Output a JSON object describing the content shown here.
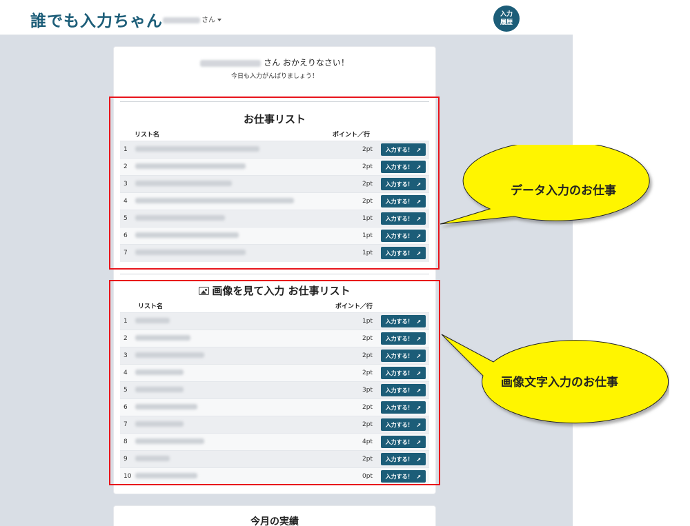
{
  "navbar": {
    "brand": "誰でも入力ちゃん",
    "user_suffix": "さん",
    "history_label_1": "入力",
    "history_label_2": "履歴"
  },
  "greeting": {
    "line1_suffix": "さん おかえりなさい！",
    "line2": "今日も入力がんばりましょう！"
  },
  "data_jobs": {
    "title": "お仕事リスト",
    "col_name": "リスト名",
    "col_points": "ポイント／行",
    "button_label": "入力する！",
    "rows": [
      {
        "num": "1",
        "points": "2pt"
      },
      {
        "num": "2",
        "points": "2pt"
      },
      {
        "num": "3",
        "points": "2pt"
      },
      {
        "num": "4",
        "points": "2pt"
      },
      {
        "num": "5",
        "points": "1pt"
      },
      {
        "num": "6",
        "points": "1pt"
      },
      {
        "num": "7",
        "points": "1pt"
      }
    ]
  },
  "image_jobs": {
    "title": "画像を見て入力 お仕事リスト",
    "icon": "image-icon",
    "col_name": "リスト名",
    "col_points": "ポイント／行",
    "button_label": "入力する！",
    "rows": [
      {
        "num": "1",
        "points": "1pt"
      },
      {
        "num": "2",
        "points": "2pt"
      },
      {
        "num": "3",
        "points": "2pt"
      },
      {
        "num": "4",
        "points": "2pt"
      },
      {
        "num": "5",
        "points": "3pt"
      },
      {
        "num": "6",
        "points": "2pt"
      },
      {
        "num": "7",
        "points": "2pt"
      },
      {
        "num": "8",
        "points": "4pt"
      },
      {
        "num": "9",
        "points": "2pt"
      },
      {
        "num": "10",
        "points": "0pt"
      }
    ]
  },
  "results": {
    "title": "今月の実績"
  },
  "callouts": {
    "data_entry": "データ入力のお仕事",
    "image_entry": "画像文字入力のお仕事"
  },
  "colors": {
    "brand": "#1c5d78",
    "highlight": "#e8141b",
    "callout_fill": "#fff500"
  }
}
